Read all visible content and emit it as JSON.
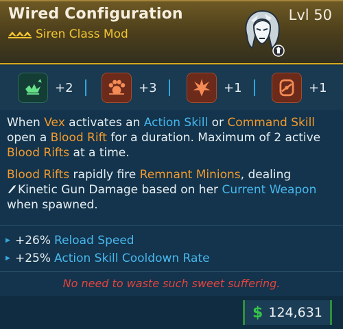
{
  "item": {
    "title": "Wired Configuration",
    "subtitle": "Siren Class Mod",
    "level": "Lvl 50",
    "rarity_icon": "rarity-chevrons-icon",
    "portrait_icon": "siren-vex-portrait-icon"
  },
  "skills": [
    {
      "icon": "green-skill-icon",
      "value": "+2"
    },
    {
      "icon": "paw-skill-icon",
      "value": "+3"
    },
    {
      "icon": "burst-skill-icon",
      "value": "+1"
    },
    {
      "icon": "gear-skill-icon",
      "value": "+1"
    }
  ],
  "description": {
    "p1": {
      "t1": "When ",
      "h1": "Vex",
      "t2": " activates an ",
      "h2": "Action Skill",
      "t3": " or ",
      "h3": "Command Skill",
      "t4": " open a ",
      "h4": "Blood Rift",
      "t5": " for a duration. Maximum of 2 active ",
      "h5": "Blood Rifts",
      "t6": " at a time."
    },
    "p2": {
      "h1": "Blood Rifts",
      "t1": " rapidly fire ",
      "h2": "Remnant Minions",
      "t2": ", dealing",
      "t3": "Kinetic Gun Damage",
      "t4": " based on her ",
      "h3": "Current Weapon",
      "t5": " when spawned."
    }
  },
  "bonuses": [
    {
      "value": "+26%",
      "name": "Reload Speed"
    },
    {
      "value": "+25%",
      "name": "Action Skill Cooldown Rate"
    }
  ],
  "flavor_text": "No need to waste such sweet suffering.",
  "price": {
    "currency_icon": "dollar-icon",
    "symbol": "$",
    "value": "124,631"
  },
  "colors": {
    "rarity_gold": "#f3c531",
    "highlight_orange": "#f39a2e",
    "highlight_blue": "#48b7ee",
    "flavor_red": "#e8433d",
    "money_green": "#35c24a"
  }
}
